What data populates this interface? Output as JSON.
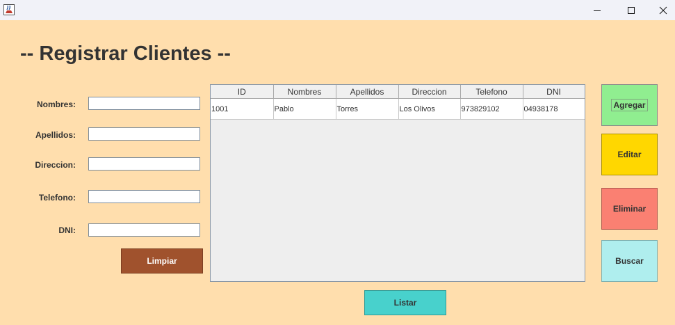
{
  "window": {
    "icons": {
      "app": "java-cup-icon",
      "minimize": "minimize-icon",
      "maximize": "maximize-icon",
      "close": "close-icon"
    }
  },
  "page": {
    "title": "-- Registrar Clientes --"
  },
  "form": {
    "fields": [
      {
        "label": "Nombres:",
        "value": ""
      },
      {
        "label": "Apellidos:",
        "value": ""
      },
      {
        "label": "Direccion:",
        "value": ""
      },
      {
        "label": "Telefono:",
        "value": ""
      },
      {
        "label": "DNI:",
        "value": ""
      }
    ],
    "clear_label": "Limpiar"
  },
  "table": {
    "columns": [
      "ID",
      "Nombres",
      "Apellidos",
      "Direccion",
      "Telefono",
      "DNI"
    ],
    "rows": [
      [
        "1001",
        "Pablo",
        "Torres",
        "Los Olivos",
        "973829102",
        "04938178"
      ]
    ]
  },
  "actions": {
    "add_label": "Agregar",
    "edit_label": "Editar",
    "delete_label": "Eliminar",
    "search_label": "Buscar",
    "list_label": "Listar"
  },
  "colors": {
    "background": "#ffdead",
    "add": "#90ee90",
    "edit": "#ffd700",
    "delete": "#fa8072",
    "search": "#afeeee",
    "list": "#48d1cc",
    "clear": "#a0522d"
  }
}
